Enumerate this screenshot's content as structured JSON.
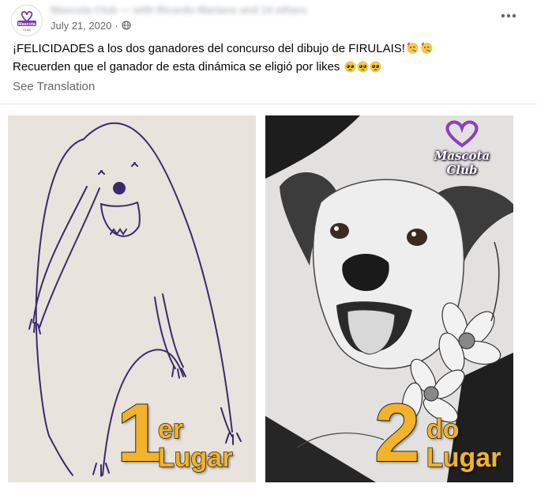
{
  "post": {
    "author_line": "Mascota Club — with Ricardo Mariano and 14 others",
    "date": "July 21, 2020",
    "date_separator": "·",
    "caption_line1": "¡FELICIDADES a los dos ganadores del concurso del dibujo de FIRULAIS!",
    "caption_line2": "Recuerden que el ganador de esta dinámica se eligió por likes",
    "see_translation": "See Translation"
  },
  "avatar": {
    "logo_text": "Mascota",
    "sub_text": "CLUB"
  },
  "images": {
    "left": {
      "place_number": "1",
      "place_suffix": "er",
      "place_word": "Lugar"
    },
    "right": {
      "place_number": "2",
      "place_suffix": "do",
      "place_word": "Lugar",
      "brand": "Mascota Club"
    }
  },
  "colors": {
    "accent_gold": "#f3b22b",
    "brand_purple": "#7a3aa8",
    "meta_gray": "#65676b"
  },
  "icons": {
    "privacy": "globe-icon",
    "more": "more-horizontal-icon",
    "emoji_line1": "face-with-party-horn-emoji",
    "emoji_line2": "pleading-face-emoji"
  }
}
